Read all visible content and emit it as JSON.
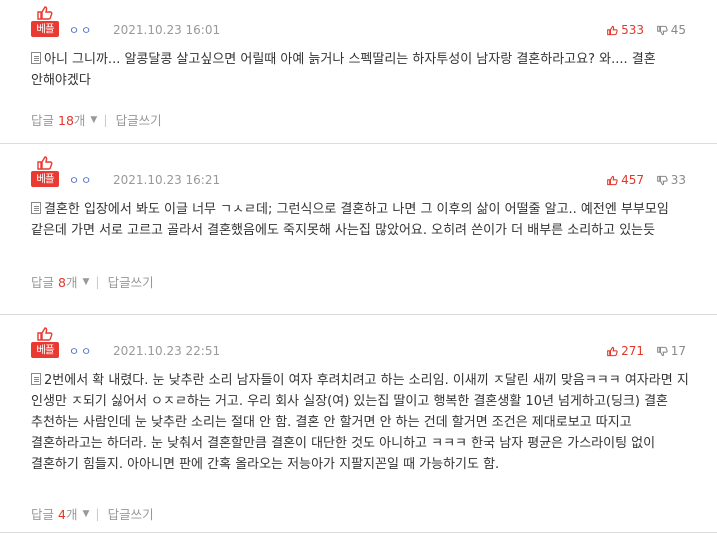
{
  "comments": [
    {
      "badge": "베플",
      "author_mark": "ㅇㅇ",
      "date": "2021.10.23 16:01",
      "likes": "533",
      "dislikes": "45",
      "text": "아니 그니까... 알콩달콩 살고싶으면 어릴때 아예 늙거나 스펙딸리는 하자투성이 남자랑 결혼하라고요? 와.... 결혼 안해야겠다",
      "reply_prefix": "답글",
      "reply_count": "18",
      "reply_suffix": "개",
      "write_reply": "답글쓰기"
    },
    {
      "badge": "베플",
      "author_mark": "ㅇㅇ",
      "date": "2021.10.23 16:21",
      "likes": "457",
      "dislikes": "33",
      "text": "결혼한 입장에서 봐도 이글 너무 ㄱㅅㄹ데; 그런식으로 결혼하고 나면 그 이후의 삶이 어떨줄 알고.. 예전엔 부부모임 같은데 가면 서로 고르고 골라서 결혼했음에도 죽지못해 사는집 많았어요. 오히려 쓴이가 더 배부른 소리하고 있는듯",
      "reply_prefix": "답글",
      "reply_count": "8",
      "reply_suffix": "개",
      "write_reply": "답글쓰기"
    },
    {
      "badge": "베플",
      "author_mark": "ㅇㅇ",
      "date": "2021.10.23 22:51",
      "likes": "271",
      "dislikes": "17",
      "text": "2번에서 확 내렸다. 눈 낮추란 소리 남자들이 여자 후려치려고 하는 소리임. 이새끼 ㅈ달린 새끼 맞음ㅋㅋㅋ 여자라면 지 인생만 ㅈ되기 싫어서 ㅇㅈㄹ하는 거고. 우리 회사 실장(여) 있는집 딸이고 행복한 결혼생활 10년 넘게하고(딩크) 결혼 추천하는 사람인데 눈 낮추란 소리는 절대 안 함. 결혼 안 할거면 안 하는 건데 할거면 조건은 제대로보고 따지고 결혼하라고는 하더라. 눈 낮춰서 결혼할만큼 결혼이 대단한 것도 아니하고 ㅋㅋㅋ 한국 남자 평균은 가스라이팅 없이 결혼하기 힘들지. 아아니면 판에 간혹 올라오는 저능아가 지팔지꼰일 때 가능하기도 함.",
      "reply_prefix": "답글",
      "reply_count": "4",
      "reply_suffix": "개",
      "write_reply": "답글쓰기"
    }
  ],
  "colors": {
    "badge": "#e83a32",
    "likes": "#e0392b",
    "dislikes": "#8a8a8a",
    "meta": "#999999"
  },
  "icons": {
    "best": "thumbs-up-icon",
    "like": "thumbs-up-icon",
    "dislike": "thumbs-down-icon",
    "reply_toggle": "caret-down-icon",
    "text": "document-icon"
  }
}
